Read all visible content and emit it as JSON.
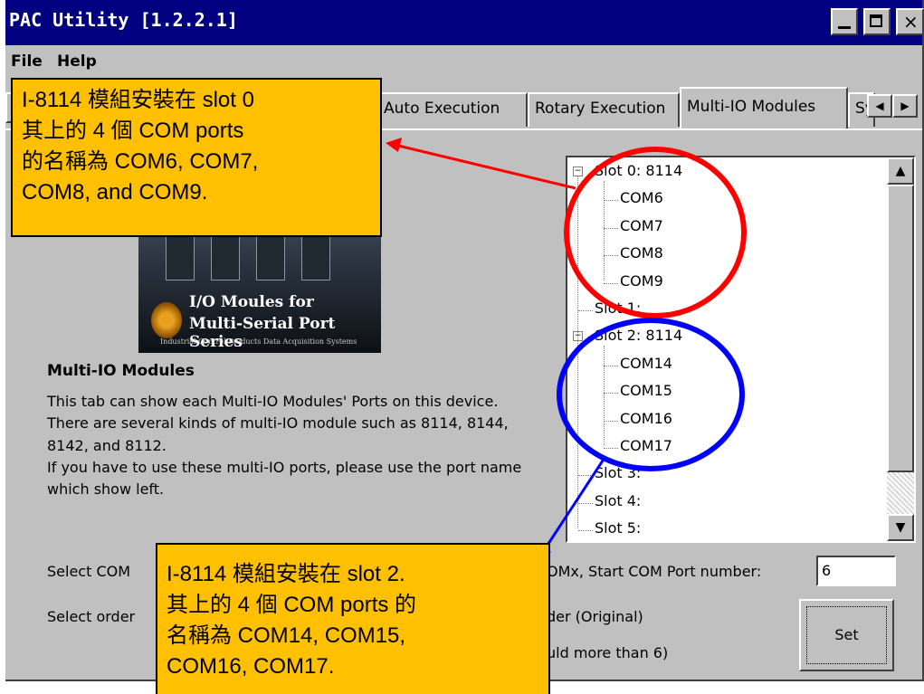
{
  "window": {
    "title": "PAC Utility  [1.2.2.1]"
  },
  "menu": {
    "file": "File",
    "help": "Help"
  },
  "tabs": [
    {
      "label": "Auto Execution"
    },
    {
      "label": "Rotary Execution"
    },
    {
      "label": "Multi-IO Modules",
      "active": true
    },
    {
      "label": "Sy"
    }
  ],
  "banner": {
    "line1": "I/O Moules for",
    "line2": "Multi-Serial Port Series",
    "line3": "Industrial Control Products Data Acquisition Systems"
  },
  "description": {
    "title": "Multi-IO Modules",
    "body": "This tab can show each Multi-IO Modules' Ports on this device.\nThere are several kinds of multi-IO module such as 8114, 8144, 8142, and 8112.\nIf you have to use these multi-IO ports, please use the port name which show left."
  },
  "tree": [
    {
      "label": "Slot 0: 8114",
      "expanded": true
    },
    {
      "label": "COM6"
    },
    {
      "label": "COM7"
    },
    {
      "label": "COM8"
    },
    {
      "label": "COM9"
    },
    {
      "label": "Slot 1:"
    },
    {
      "label": "Slot 2: 8114",
      "expanded": true
    },
    {
      "label": "COM14"
    },
    {
      "label": "COM15"
    },
    {
      "label": "COM16"
    },
    {
      "label": "COM17"
    },
    {
      "label": "Slot 3:"
    },
    {
      "label": "Slot 4:"
    },
    {
      "label": "Slot 5:"
    }
  ],
  "settings": {
    "select_com_label": "Select COM",
    "start_port_label": "OMx, Start COM Port number:",
    "start_port_value": "6",
    "select_order_label": "Select order",
    "order_option": "der (Original)",
    "order_note": "uld more than 6)",
    "set_button": "Set"
  },
  "callouts": {
    "top": "I-8114 模組安裝在 slot 0\n其上的 4 個 COM ports\n的名稱為  COM6, COM7,\nCOM8, and COM9.",
    "bottom": "I-8114  模組安裝在 slot 2.\n其上的  4  個 COM ports  的\n名稱為  COM14, COM15,\nCOM16, COM17."
  },
  "colors": {
    "titlebar": "#000080",
    "window_bg": "#c0c0c0",
    "callout_fill": "#fec000",
    "highlight_red": "#ff0000",
    "highlight_blue": "#0000ff"
  }
}
